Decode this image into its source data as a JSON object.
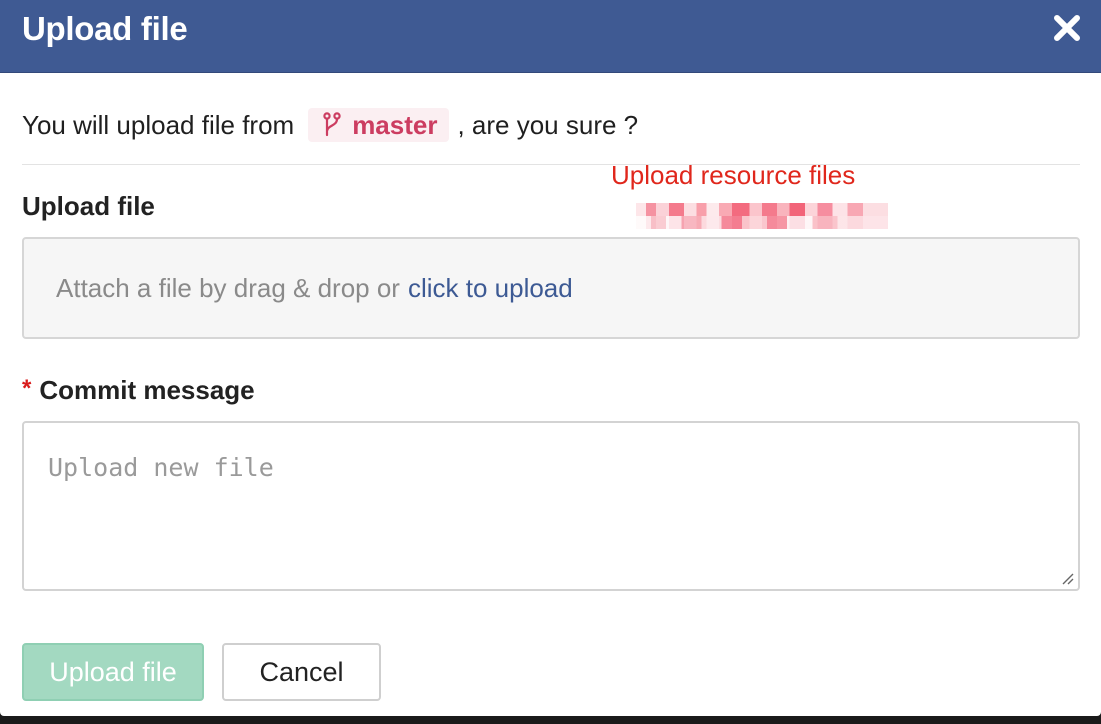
{
  "dialog": {
    "title": "Upload file",
    "close_icon": "close-icon"
  },
  "confirm": {
    "prefix": "You will upload file from",
    "branch_icon": "git-branch-icon",
    "branch": "master",
    "suffix": ", are you sure ?"
  },
  "annotation": {
    "text": "Upload resource files",
    "color": "#e0271c"
  },
  "upload_section": {
    "label": "Upload file",
    "dropzone_text": "Attach a file by drag & drop or",
    "dropzone_link": "click to upload"
  },
  "commit_section": {
    "required_mark": "*",
    "label": "Commit message",
    "placeholder": "Upload new file"
  },
  "actions": {
    "primary_label": "Upload file",
    "cancel_label": "Cancel"
  },
  "colors": {
    "header": "#3f5a93",
    "branch_chip_bg": "#fbeff2",
    "branch_text": "#cc3d61",
    "link": "#3d5a94",
    "primary_button_disabled": "#a3d9c1"
  }
}
